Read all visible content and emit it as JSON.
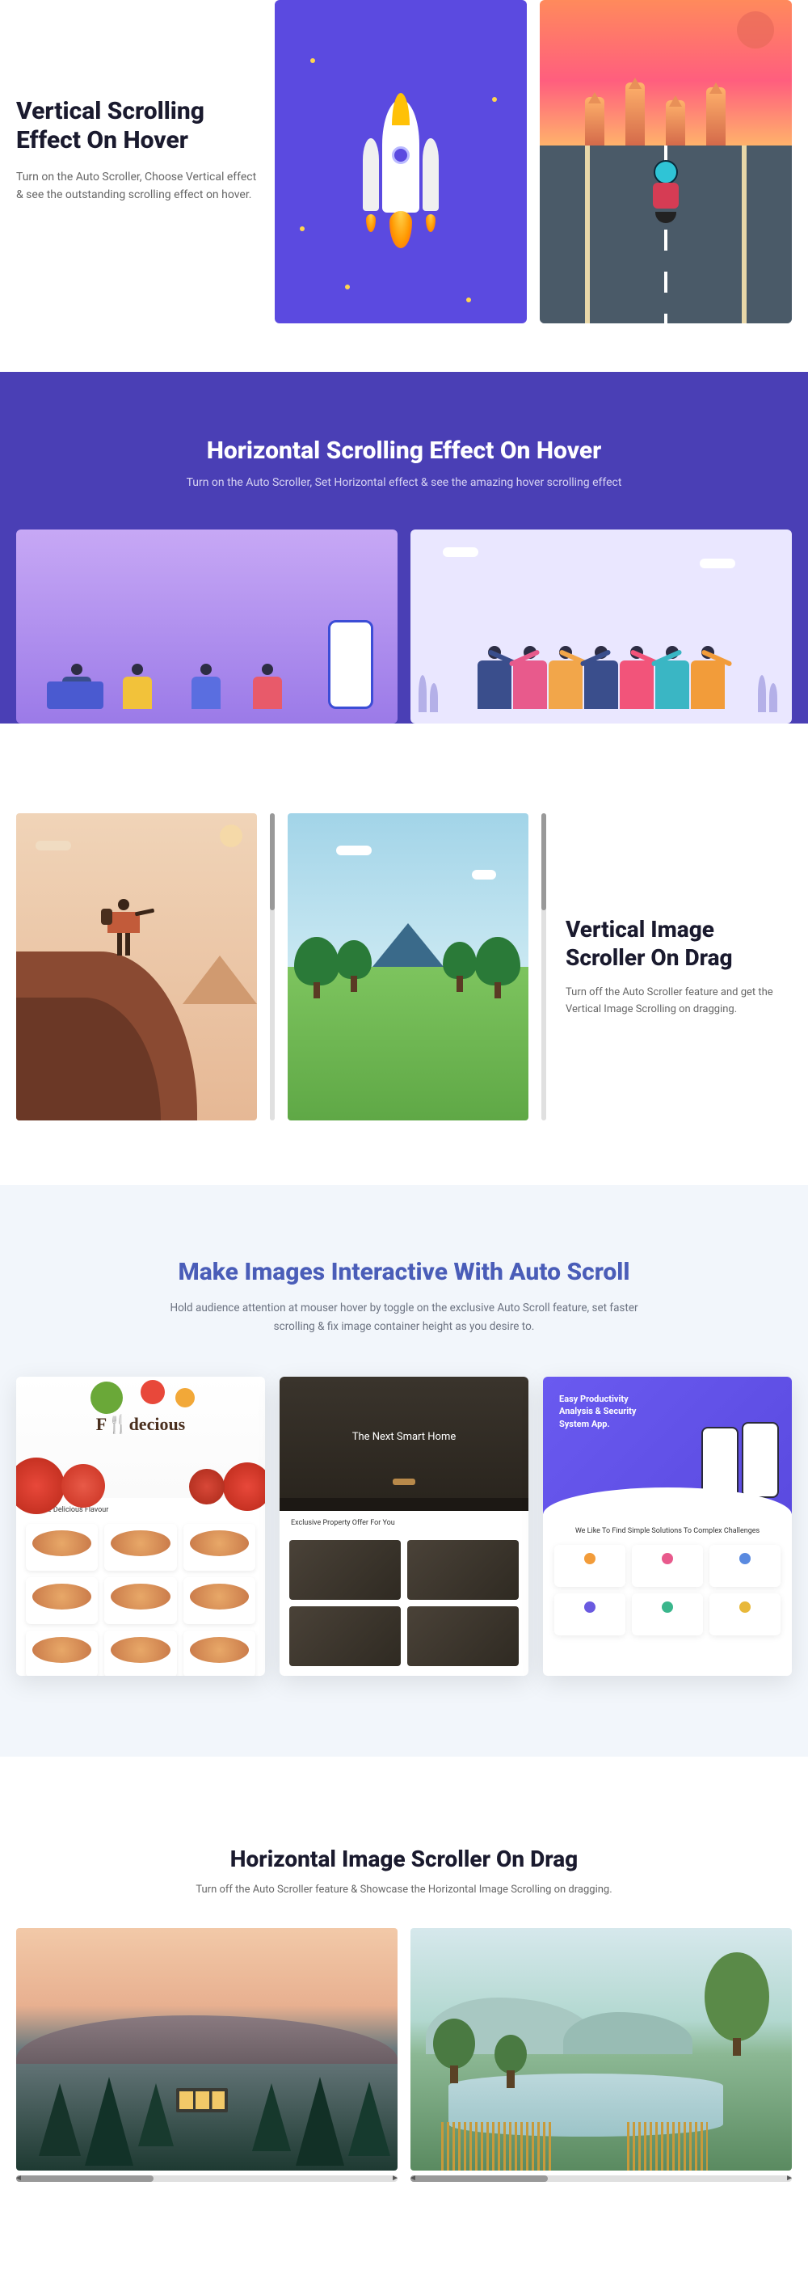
{
  "sec1": {
    "title": "Vertical Scrolling Effect On Hover",
    "desc": "Turn on the Auto Scroller, Choose Vertical effect & see the outstanding scrolling effect on hover."
  },
  "sec2": {
    "title": "Horizontal Scrolling Effect On Hover",
    "desc": "Turn on the Auto Scroller, Set Horizontal effect & see the amazing hover scrolling effect"
  },
  "sec3": {
    "title": "Vertical Image Scroller On Drag",
    "desc": "Turn off the Auto Scroller feature and get the Vertical Image Scrolling on dragging."
  },
  "sec4": {
    "title": "Make Images Interactive With Auto Scroll",
    "desc": "Hold audience attention at mouser hover by toggle on the exclusive Auto Scroll feature, set faster scrolling & fix image container height as you desire to.",
    "site1_logo": "F🍴decious",
    "site1_sub": "Explore Delicious Flavour",
    "site2_hero": "The Next Smart Home",
    "site2_sub": "Exclusive Property Offer For You",
    "site3_hero": "Easy Productivity Analysis & Security System App.",
    "site3_mid": "We Like To Find Simple Solutions To Complex Challenges"
  },
  "sec5": {
    "title": "Horizontal Image Scroller On Drag",
    "desc": "Turn off the Auto Scroller feature & Showcase the Horizontal Image Scrolling on dragging."
  },
  "friend_colors": [
    "#3a4e8c",
    "#e85a8c",
    "#f2a64a",
    "#3a4e8c",
    "#f2547a",
    "#3ab6c4",
    "#f29c3a"
  ]
}
